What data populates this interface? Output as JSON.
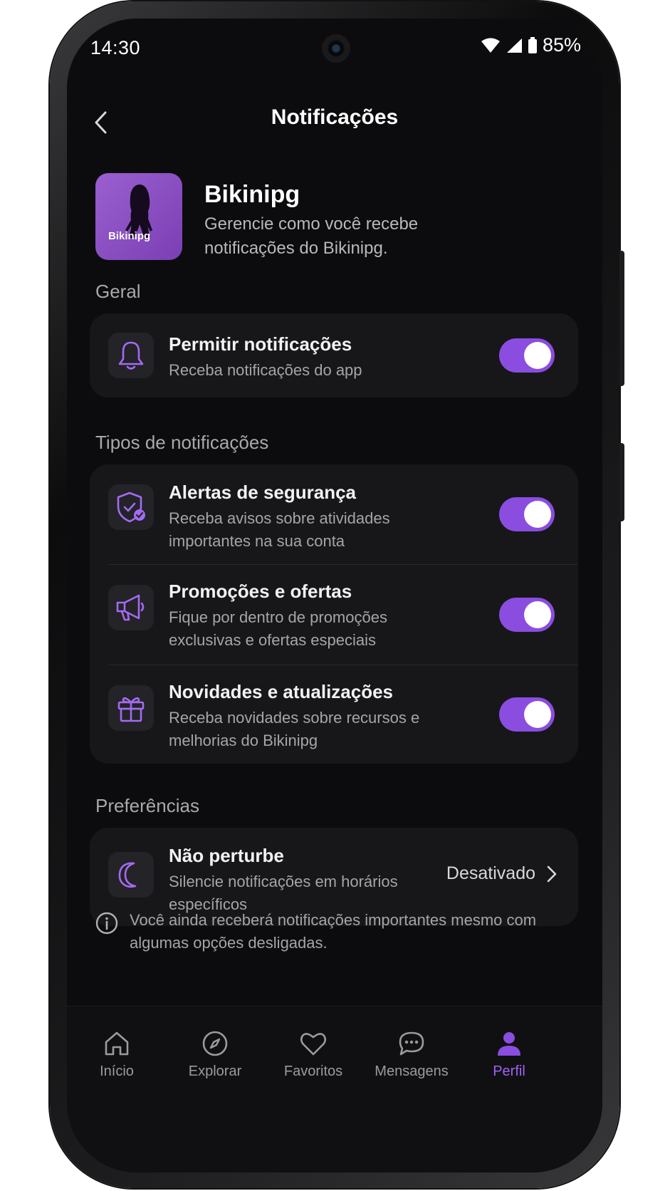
{
  "status_bar": {
    "time": "14:30",
    "battery": "85%"
  },
  "header": {
    "title": "Notificações"
  },
  "app": {
    "logo_text": "Bikinipg",
    "name": "Bikinipg",
    "description": "Gerencie como você recebe notificações do Bikinipg."
  },
  "sections": {
    "general": "Geral",
    "types": "Tipos de notificações",
    "preferences": "Preferências"
  },
  "general_items": [
    {
      "title": "Permitir notificações",
      "subtitle": "Receba notificações do app",
      "enabled": true,
      "icon": "bell-icon"
    }
  ],
  "type_items": [
    {
      "title": "Alertas de segurança",
      "subtitle": "Receba avisos sobre atividades importantes na sua conta",
      "enabled": true,
      "icon": "shield-check-icon"
    },
    {
      "title": "Promoções e ofertas",
      "subtitle": "Fique por dentro de promoções exclusivas e ofertas especiais",
      "enabled": true,
      "icon": "megaphone-icon"
    },
    {
      "title": "Novidades e atualizações",
      "subtitle": "Receba novidades sobre recursos e melhorias do Bikinipg",
      "enabled": true,
      "icon": "gift-icon"
    }
  ],
  "preferences_items": [
    {
      "title": "Não perturbe",
      "subtitle": "Silencie notificações em horários específicos",
      "value": "Desativado",
      "icon": "moon-icon"
    }
  ],
  "info": {
    "text": "Você ainda receberá notificações importantes mesmo com algumas opções desligadas."
  },
  "nav": [
    {
      "label": "Início",
      "icon": "home-icon",
      "active": false
    },
    {
      "label": "Explorar",
      "icon": "compass-icon",
      "active": false
    },
    {
      "label": "Favoritos",
      "icon": "heart-icon",
      "active": false
    },
    {
      "label": "Mensagens",
      "icon": "chat-icon",
      "active": false
    },
    {
      "label": "Perfil",
      "icon": "user-icon",
      "active": true
    }
  ],
  "colors": {
    "accent": "#8A4DE0",
    "background": "#0C0C0E",
    "card": "#17171A"
  }
}
